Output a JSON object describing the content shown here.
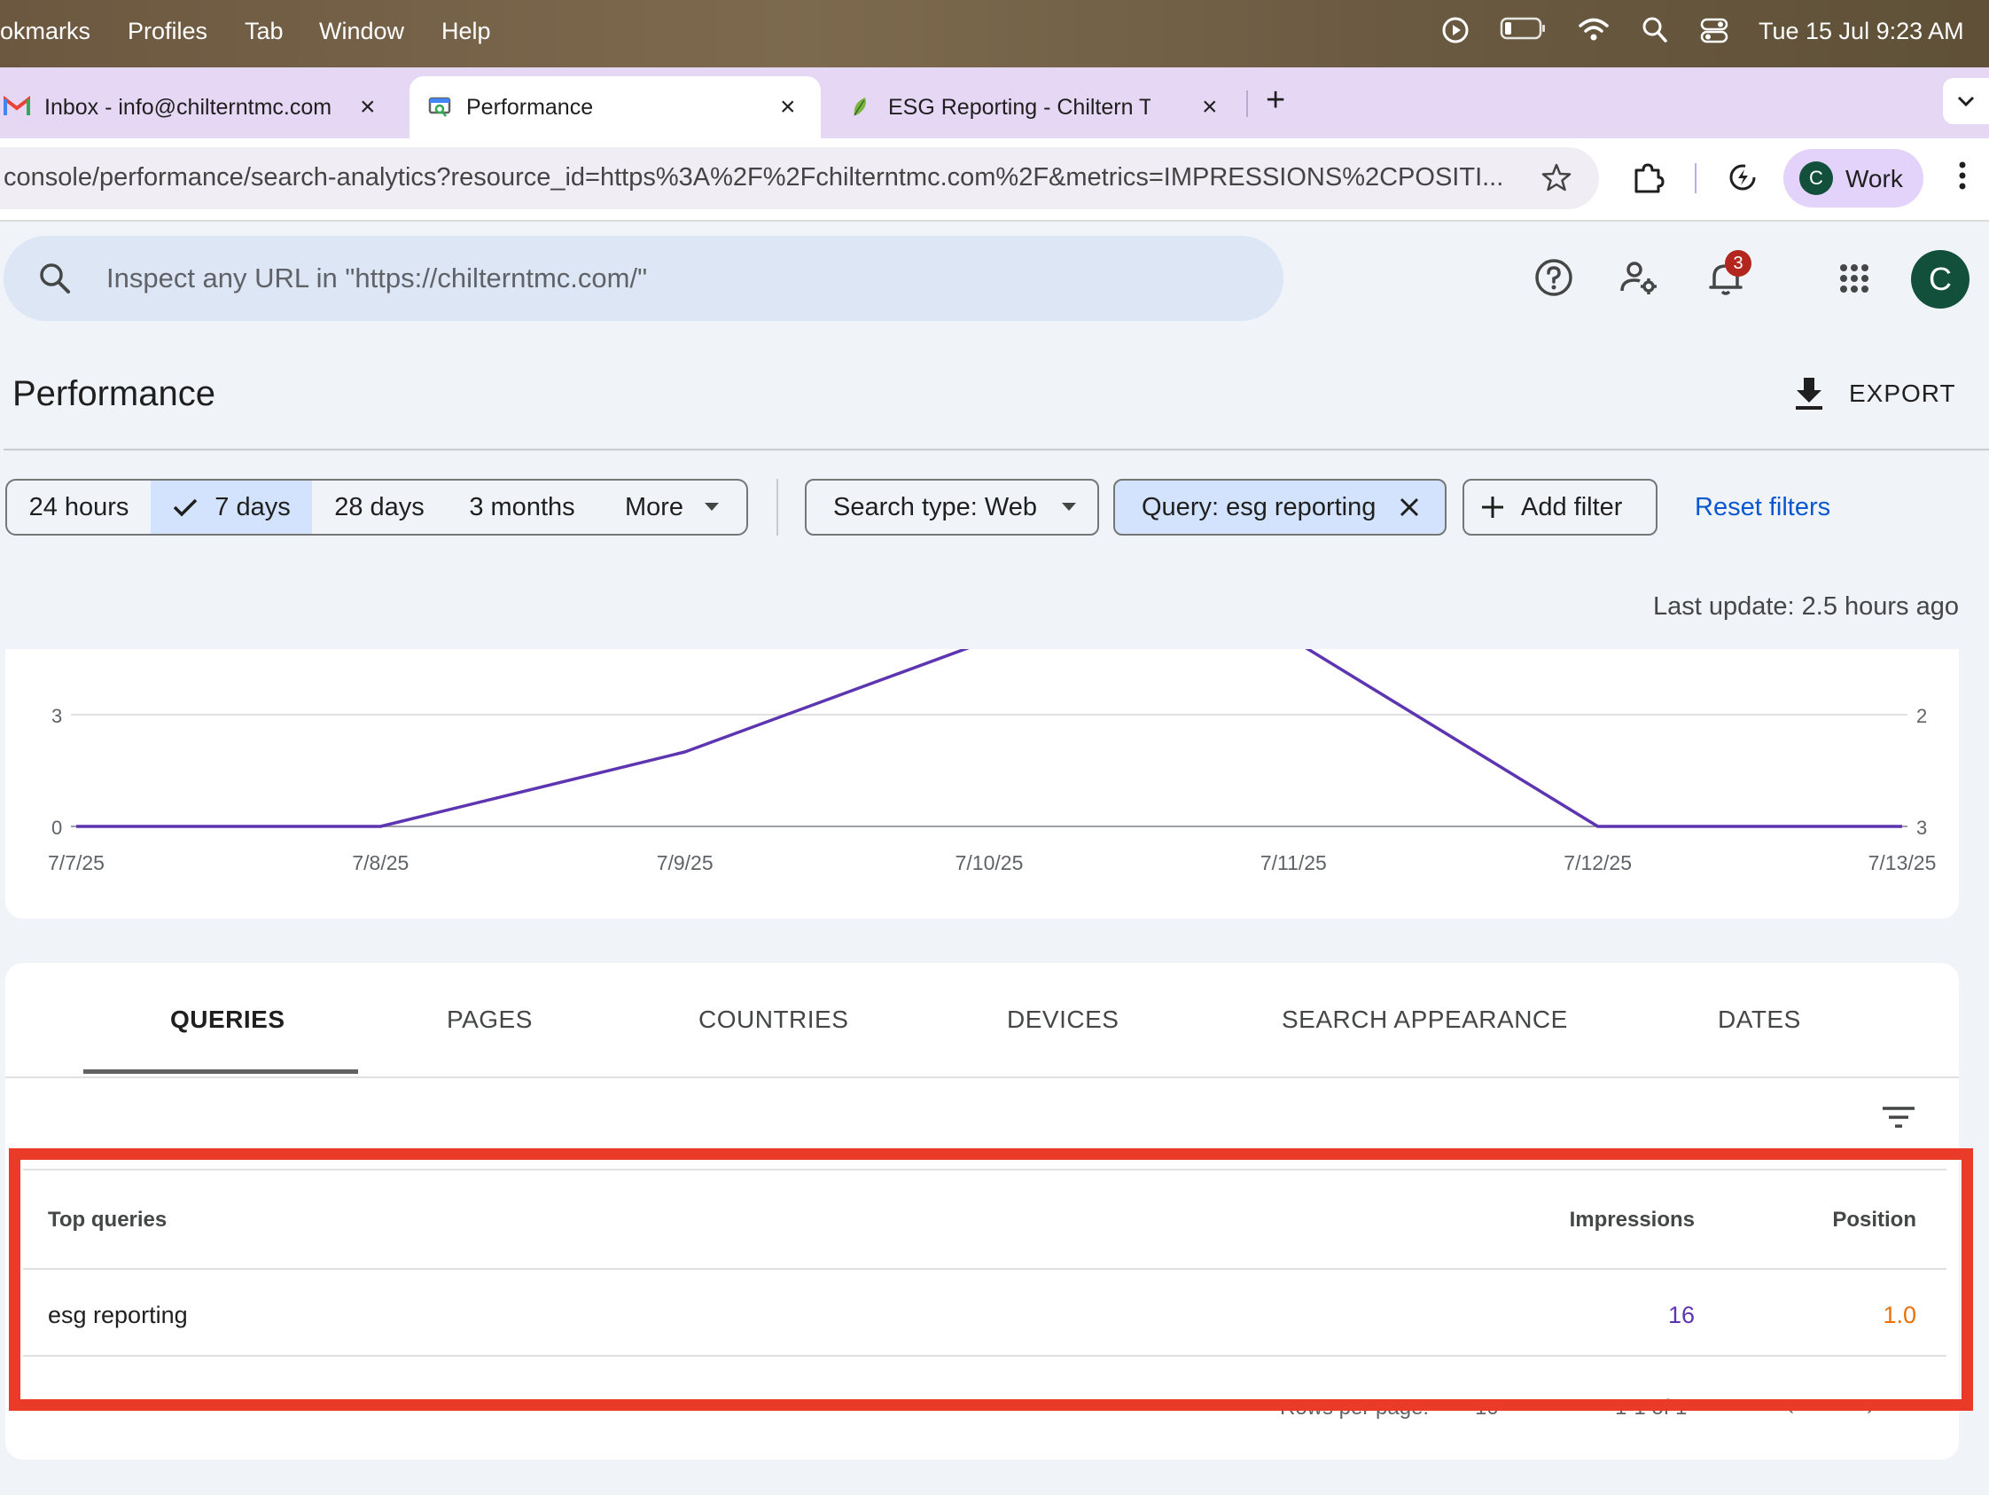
{
  "menubar": {
    "items": [
      "okmarks",
      "Profiles",
      "Tab",
      "Window",
      "Help"
    ],
    "clock": "Tue 15 Jul  9:23 AM"
  },
  "tabs": [
    {
      "title": "Inbox - info@chilterntmc.com",
      "icon": "gmail-icon"
    },
    {
      "title": "Performance",
      "icon": "search-console-icon"
    },
    {
      "title": "ESG Reporting - Chiltern TMC",
      "icon": "leaf-site-icon"
    }
  ],
  "address": {
    "url": "console/performance/search-analytics?resource_id=https%3A%2F%2Fchilterntmc.com%2F&metrics=IMPRESSIONS%2CPOSITI..."
  },
  "profile": {
    "initial": "C",
    "label": "Work"
  },
  "inspect": {
    "placeholder": "Inspect any URL in \"https://chilterntmc.com/\""
  },
  "notifications": {
    "count": "3"
  },
  "account": {
    "initial": "C"
  },
  "page": {
    "title": "Performance",
    "export_label": "EXPORT"
  },
  "date_range": {
    "options": [
      "24 hours",
      "7 days",
      "28 days",
      "3 months",
      "More"
    ],
    "selected": "7 days"
  },
  "filters": {
    "search_type": "Search type: Web",
    "query": "Query: esg reporting",
    "add_filter": "Add filter",
    "reset": "Reset filters"
  },
  "last_update": "Last update: 2.5 hours ago",
  "chart_data": {
    "type": "line",
    "categories": [
      "7/7/25",
      "7/8/25",
      "7/9/25",
      "7/10/25",
      "7/11/25",
      "7/12/25",
      "7/13/25"
    ],
    "series": [
      {
        "values": [
          0,
          0,
          2,
          5,
          5,
          0,
          0
        ],
        "color": "#5e35b1"
      }
    ],
    "left_axis_ticks": [
      "3",
      "0"
    ],
    "right_axis_ticks": [
      "2",
      "3"
    ],
    "ylim": [
      0,
      4.5
    ],
    "grid": true
  },
  "report_tabs": [
    "QUERIES",
    "PAGES",
    "COUNTRIES",
    "DEVICES",
    "SEARCH APPEARANCE",
    "DATES"
  ],
  "table": {
    "headers": {
      "query": "Top queries",
      "impressions": "Impressions",
      "position": "Position"
    },
    "rows": [
      {
        "query": "esg reporting",
        "impressions": "16",
        "position": "1.0"
      }
    ],
    "pager": {
      "rows_per_page_label": "Rows per page:",
      "rows_per_page": "10",
      "range": "1-1 of 1"
    }
  },
  "colors": {
    "impressions": "#5e35b1",
    "position": "#e8710a",
    "selected_chip": "#d3e3fd",
    "highlight": "#ea3a28",
    "link": "#0b57d0"
  }
}
